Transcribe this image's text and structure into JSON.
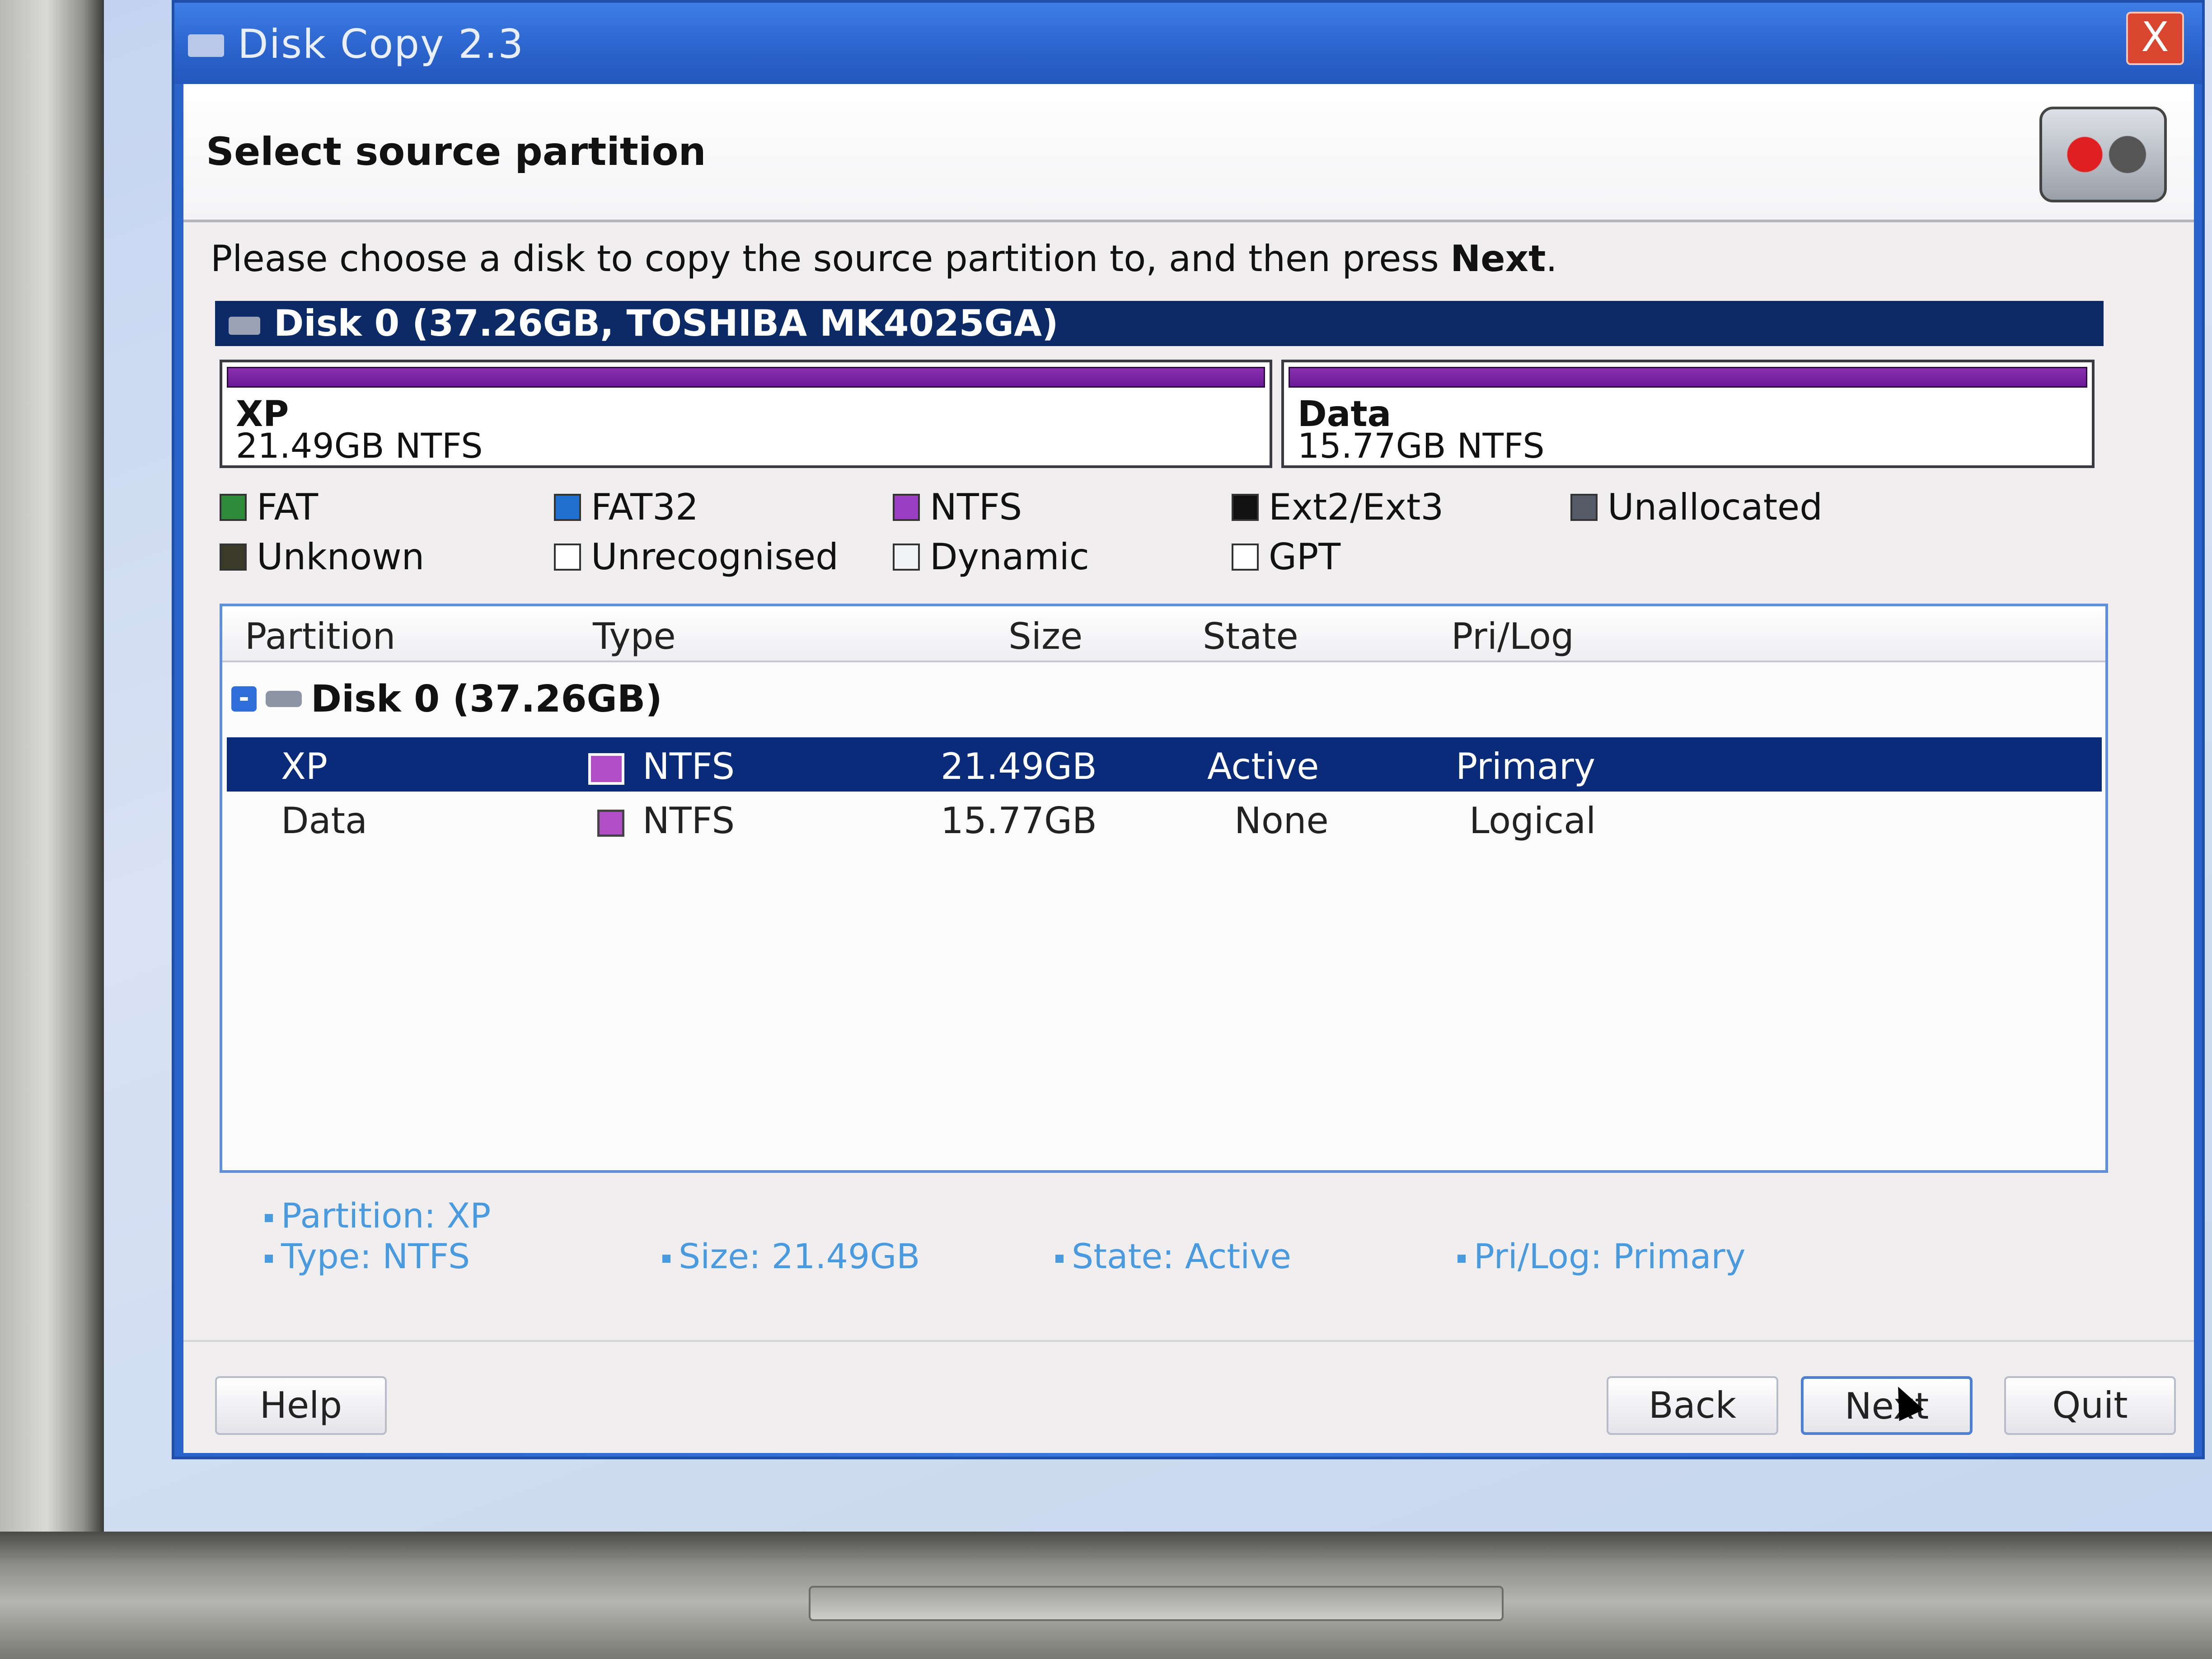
{
  "window": {
    "title": "Disk Copy 2.3",
    "close_label": "X"
  },
  "header": {
    "title": "Select source partition"
  },
  "instruction": {
    "text_before": "Please choose a disk to copy the source partition to, and then press ",
    "bold_word": "Next",
    "text_after": "."
  },
  "disk_bar": {
    "label": "Disk 0 (37.26GB, TOSHIBA MK4025GA)"
  },
  "partition_map": [
    {
      "name": "XP",
      "detail": "21.49GB NTFS",
      "size_gb": 21.49
    },
    {
      "name": "Data",
      "detail": "15.77GB NTFS",
      "size_gb": 15.77
    }
  ],
  "legend": [
    {
      "label": "FAT",
      "color": "#2e8b3a"
    },
    {
      "label": "FAT32",
      "color": "#1f6fd0"
    },
    {
      "label": "NTFS",
      "color": "#9b3fc2"
    },
    {
      "label": "Ext2/Ext3",
      "color": "#111111"
    },
    {
      "label": "Unallocated",
      "color": "#555b66"
    },
    {
      "label": "Unknown",
      "color": "#3a3a2a"
    },
    {
      "label": "Unrecognised",
      "color": "#ffffff"
    },
    {
      "label": "Dynamic",
      "color": "#f2f4f8"
    },
    {
      "label": "GPT",
      "color": "#ffffff"
    }
  ],
  "table": {
    "columns": [
      "Partition",
      "Type",
      "Size",
      "State",
      "Pri/Log"
    ],
    "tree_node": "Disk 0 (37.26GB)",
    "tree_toggle": "-",
    "rows": [
      {
        "partition": "XP",
        "type": "NTFS",
        "size": "21.49GB",
        "state": "Active",
        "prilog": "Primary",
        "selected": true
      },
      {
        "partition": "Data",
        "type": "NTFS",
        "size": "15.77GB",
        "state": "None",
        "prilog": "Logical",
        "selected": false
      }
    ]
  },
  "details": {
    "partition": "Partition: XP",
    "type": "Type: NTFS",
    "size": "Size: 21.49GB",
    "state": "State: Active",
    "prilog": "Pri/Log: Primary"
  },
  "buttons": {
    "help": "Help",
    "back": "Back",
    "next": "Next",
    "quit": "Quit"
  }
}
